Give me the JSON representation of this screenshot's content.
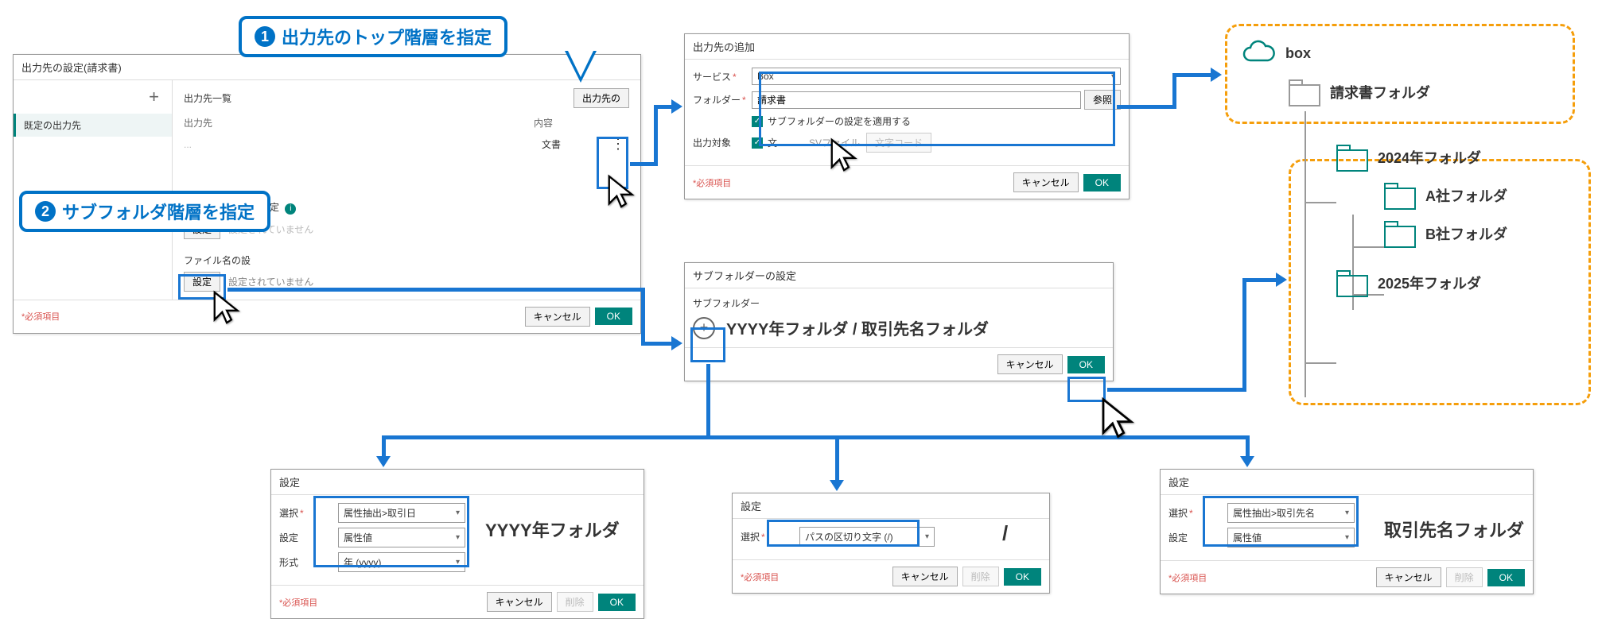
{
  "callouts": {
    "step1": "出力先のトップ階層を指定",
    "step2": "サブフォルダ階層を指定"
  },
  "main_dialog": {
    "title": "出力先の設定(請求書)",
    "tab_default": "既定の出力先",
    "list_title": "出力先一覧",
    "add_button": "出力先の",
    "col_output": "出力先",
    "col_content": "内容",
    "row1_content": "文書",
    "subfolder_section": "サブフォルダーの設定",
    "settings_btn": "設定",
    "not_set": "設定されていません",
    "filename_section": "ファイル名の設",
    "required": "*必須項目",
    "cancel": "キャンセル",
    "ok": "OK"
  },
  "add_dialog": {
    "title": "出力先の追加",
    "service_label": "サービス",
    "service_value": "Box",
    "folder_label": "フォルダー",
    "folder_value": "請求書",
    "browse": "参照",
    "apply_sub": "サブフォルダーの設定を適用する",
    "output_target_label": "出力対象",
    "output_target_opt1": "文",
    "output_target_opt2": "SVファイル",
    "charcode": "文字コード",
    "required": "*必須項目",
    "cancel": "キャンセル",
    "ok": "OK"
  },
  "subfolder_dialog": {
    "title": "サブフォルダーの設定",
    "label": "サブフォルダー",
    "preview": "YYYY年フォルダ / 取引先名フォルダ",
    "cancel": "キャンセル",
    "ok": "OK"
  },
  "settings1": {
    "title": "設定",
    "select_label": "選択",
    "select_value": "属性抽出>取引日",
    "setting_label": "設定",
    "setting_value": "属性値",
    "format_label": "形式",
    "format_value": "年 (yyyy)",
    "required": "*必須項目",
    "cancel": "キャンセル",
    "delete": "削除",
    "ok": "OK",
    "result": "YYYY年フォルダ"
  },
  "settings2": {
    "title": "設定",
    "select_label": "選択",
    "select_value": "パスの区切り文字 (/)",
    "required": "*必須項目",
    "cancel": "キャンセル",
    "delete": "削除",
    "ok": "OK",
    "result": "/"
  },
  "settings3": {
    "title": "設定",
    "select_label": "選択",
    "select_value": "属性抽出>取引先名",
    "setting_label": "設定",
    "setting_value": "属性値",
    "required": "*必須項目",
    "cancel": "キャンセル",
    "delete": "削除",
    "ok": "OK",
    "result": "取引先名フォルダ"
  },
  "tree": {
    "service": "box",
    "root": "請求書フォルダ",
    "y2024": "2024年フォルダ",
    "companyA": "A社フォルダ",
    "companyB": "B社フォルダ",
    "y2025": "2025年フォルダ"
  }
}
